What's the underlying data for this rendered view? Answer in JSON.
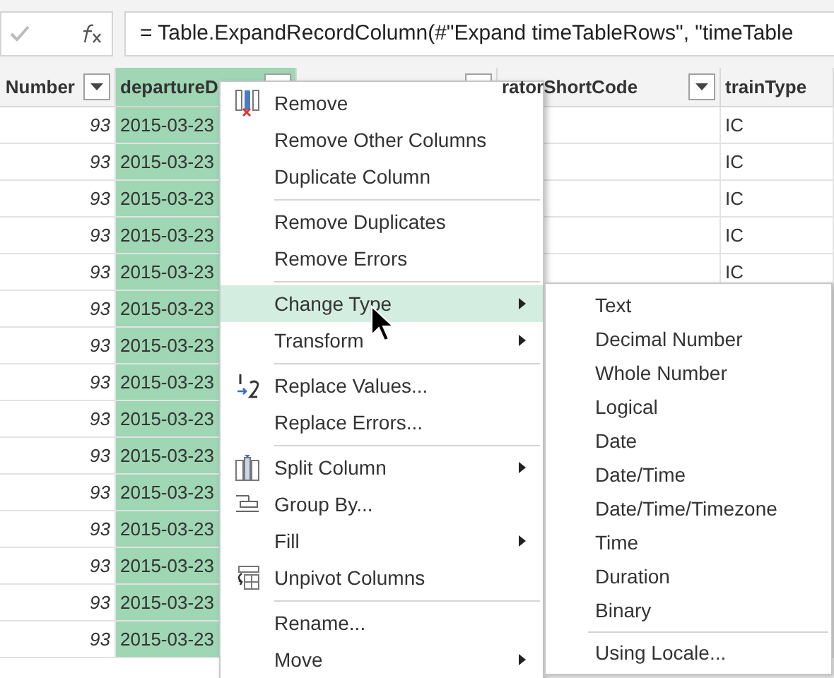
{
  "formula_bar": {
    "formula": "= Table.ExpandRecordColumn(#\"Expand timeTableRows\", \"timeTable"
  },
  "table": {
    "columns": [
      {
        "label": "Number",
        "selected": false
      },
      {
        "label": "departureD",
        "selected": true
      },
      {
        "selected": false
      },
      {
        "label": "ratorShortCode",
        "selected": false
      },
      {
        "label": "trainType",
        "selected": false
      }
    ],
    "rows": [
      {
        "cells": [
          "93",
          "2015-03-23",
          "",
          "",
          "IC"
        ]
      },
      {
        "cells": [
          "93",
          "2015-03-23",
          "",
          "",
          "IC"
        ]
      },
      {
        "cells": [
          "93",
          "2015-03-23",
          "",
          "",
          "IC"
        ]
      },
      {
        "cells": [
          "93",
          "2015-03-23",
          "",
          "",
          "IC"
        ]
      },
      {
        "cells": [
          "93",
          "2015-03-23",
          "",
          "",
          "IC"
        ]
      },
      {
        "cells": [
          "93",
          "2015-03-23",
          "",
          "",
          ""
        ]
      },
      {
        "cells": [
          "93",
          "2015-03-23",
          "",
          "",
          ""
        ]
      },
      {
        "cells": [
          "93",
          "2015-03-23",
          "",
          "",
          ""
        ]
      },
      {
        "cells": [
          "93",
          "2015-03-23",
          "",
          "",
          ""
        ]
      },
      {
        "cells": [
          "93",
          "2015-03-23",
          "",
          "",
          ""
        ]
      },
      {
        "cells": [
          "93",
          "2015-03-23",
          "",
          "",
          ""
        ]
      },
      {
        "cells": [
          "93",
          "2015-03-23",
          "",
          "",
          ""
        ]
      },
      {
        "cells": [
          "93",
          "2015-03-23",
          "",
          "",
          ""
        ]
      },
      {
        "cells": [
          "93",
          "2015-03-23",
          "",
          "",
          ""
        ]
      },
      {
        "cells": [
          "93",
          "2015-03-23",
          "",
          "",
          ""
        ]
      }
    ]
  },
  "context_menu": {
    "items": [
      {
        "kind": "item",
        "label": "Remove",
        "submenu": false,
        "selected": false
      },
      {
        "kind": "item",
        "label": "Remove Other Columns",
        "submenu": false,
        "selected": false
      },
      {
        "kind": "item",
        "label": "Duplicate Column",
        "submenu": false,
        "selected": false
      },
      {
        "kind": "separator"
      },
      {
        "kind": "item",
        "label": "Remove Duplicates",
        "submenu": false,
        "selected": false
      },
      {
        "kind": "item",
        "label": "Remove Errors",
        "submenu": false,
        "selected": false
      },
      {
        "kind": "separator"
      },
      {
        "kind": "item",
        "label": "Change Type",
        "submenu": true,
        "selected": true
      },
      {
        "kind": "item",
        "label": "Transform",
        "submenu": true,
        "selected": false
      },
      {
        "kind": "separator"
      },
      {
        "kind": "item",
        "label": "Replace Values...",
        "submenu": false,
        "selected": false
      },
      {
        "kind": "item",
        "label": "Replace Errors...",
        "submenu": false,
        "selected": false
      },
      {
        "kind": "separator"
      },
      {
        "kind": "item",
        "label": "Split Column",
        "submenu": true,
        "selected": false
      },
      {
        "kind": "item",
        "label": "Group By...",
        "submenu": false,
        "selected": false
      },
      {
        "kind": "item",
        "label": "Fill",
        "submenu": true,
        "selected": false
      },
      {
        "kind": "item",
        "label": "Unpivot Columns",
        "submenu": false,
        "selected": false
      },
      {
        "kind": "separator"
      },
      {
        "kind": "item",
        "label": "Rename...",
        "submenu": false,
        "selected": false
      },
      {
        "kind": "item",
        "label": "Move",
        "submenu": true,
        "selected": false
      }
    ]
  },
  "submenu": {
    "items": [
      {
        "kind": "item",
        "label": "Text"
      },
      {
        "kind": "item",
        "label": "Decimal Number"
      },
      {
        "kind": "item",
        "label": "Whole Number"
      },
      {
        "kind": "item",
        "label": "Logical"
      },
      {
        "kind": "item",
        "label": "Date"
      },
      {
        "kind": "item",
        "label": "Date/Time"
      },
      {
        "kind": "item",
        "label": "Date/Time/Timezone"
      },
      {
        "kind": "item",
        "label": "Time"
      },
      {
        "kind": "item",
        "label": "Duration"
      },
      {
        "kind": "item",
        "label": "Binary"
      },
      {
        "kind": "separator"
      },
      {
        "kind": "item",
        "label": "Using Locale..."
      }
    ]
  }
}
